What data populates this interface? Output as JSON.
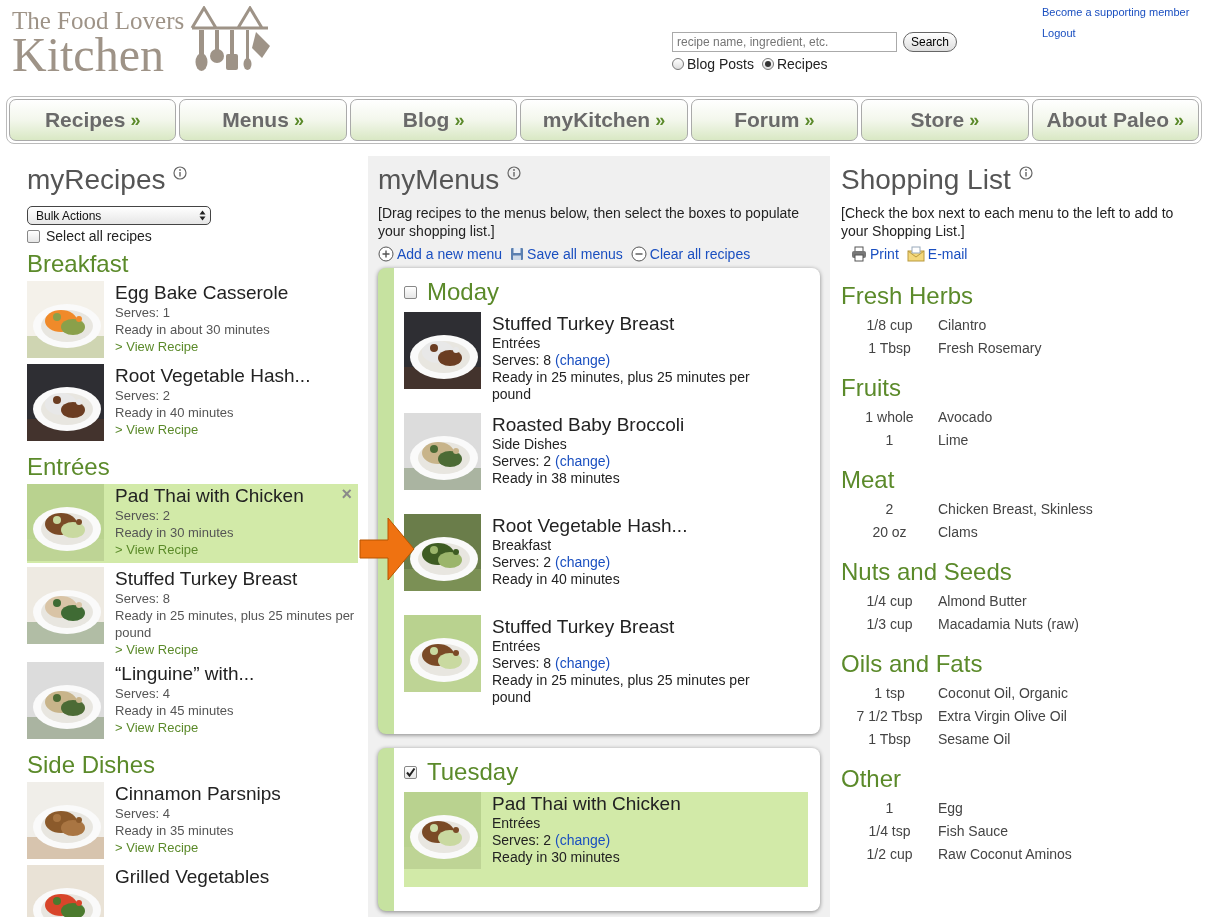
{
  "header": {
    "logo": {
      "line1": "The Food Lovers",
      "line2": "Kitchen"
    },
    "search": {
      "placeholder": "recipe name, ingredient, etc.",
      "button": "Search"
    },
    "scopes": [
      {
        "label": "Blog Posts",
        "selected": false
      },
      {
        "label": "Recipes",
        "selected": true
      }
    ],
    "account_links": [
      "Become a supporting member",
      "Logout"
    ]
  },
  "nav": [
    {
      "label": "Recipes",
      "suffix": "»"
    },
    {
      "label": "Menus",
      "suffix": "»"
    },
    {
      "label": "Blog",
      "suffix": "»"
    },
    {
      "label": "myKitchen",
      "suffix": "»"
    },
    {
      "label": "Forum",
      "suffix": "»"
    },
    {
      "label": "Store",
      "suffix": "»"
    },
    {
      "label": "About Paleo",
      "suffix": "»"
    }
  ],
  "my_recipes": {
    "title": "myRecipes",
    "bulk_actions": "Bulk Actions",
    "select_all": {
      "label": "Select all recipes",
      "checked": false
    },
    "groups": [
      {
        "name": "Breakfast",
        "recipes": [
          {
            "title": "Egg Bake Casserole",
            "serves": "Serves: 1",
            "ready": "Ready in about 30 minutes",
            "link": "> View Recipe",
            "highlighted": false
          },
          {
            "title": "Root Vegetable Hash...",
            "serves": "Serves: 2",
            "ready": "Ready in 40 minutes",
            "link": "> View Recipe",
            "highlighted": false
          }
        ]
      },
      {
        "name": "Entrées",
        "recipes": [
          {
            "title": "Pad Thai with Chicken",
            "serves": "Serves: 2",
            "ready": "Ready in 30 minutes",
            "link": "> View Recipe",
            "highlighted": true,
            "remove": "×"
          },
          {
            "title": "Stuffed Turkey Breast",
            "serves": "Serves: 8",
            "ready": "Ready in 25 minutes, plus 25 minutes per pound",
            "link": "> View Recipe",
            "highlighted": false
          },
          {
            "title": "“Linguine” with...",
            "serves": "Serves: 4",
            "ready": "Ready in 45 minutes",
            "link": "> View Recipe",
            "highlighted": false
          }
        ]
      },
      {
        "name": "Side Dishes",
        "recipes": [
          {
            "title": "Cinnamon Parsnips",
            "serves": "Serves: 4",
            "ready": "Ready in 35 minutes",
            "link": "> View Recipe",
            "highlighted": false
          },
          {
            "title": "Grilled Vegetables",
            "highlighted": false
          }
        ]
      }
    ]
  },
  "my_menus": {
    "title": "myMenus",
    "instructions": "[Drag recipes to the menus below, then select the boxes to populate your shopping list.]",
    "actions": [
      {
        "kind": "add",
        "label": "Add a new menu"
      },
      {
        "kind": "save",
        "label": "Save all menus"
      },
      {
        "kind": "clear",
        "label": "Clear all recipes"
      }
    ],
    "menus": [
      {
        "name": "Moday",
        "checked": false,
        "items": [
          {
            "title": "Stuffed Turkey Breast",
            "category": "Entrées",
            "serves": "Serves: 8",
            "change": "(change)",
            "ready": "Ready in 25 minutes, plus 25 minutes per pound",
            "highlighted": false
          },
          {
            "title": "Roasted Baby Broccoli",
            "category": "Side Dishes",
            "serves": "Serves: 2",
            "change": "(change)",
            "ready": "Ready in 38 minutes",
            "highlighted": false
          },
          {
            "title": "Root Vegetable Hash...",
            "category": "Breakfast",
            "serves": "Serves: 2",
            "change": "(change)",
            "ready": "Ready in 40 minutes",
            "highlighted": false
          },
          {
            "title": "Stuffed Turkey Breast",
            "category": "Entrées",
            "serves": "Serves: 8",
            "change": "(change)",
            "ready": "Ready in 25 minutes, plus 25 minutes per pound",
            "highlighted": false
          }
        ]
      },
      {
        "name": "Tuesday",
        "checked": true,
        "items": [
          {
            "title": "Pad Thai with Chicken",
            "category": "Entrées",
            "serves": "Serves: 2",
            "change": "(change)",
            "ready": "Ready in 30 minutes",
            "highlighted": true
          }
        ]
      }
    ]
  },
  "shopping_list": {
    "title": "Shopping List",
    "instructions": "[Check the box next to each menu to the left to add to your Shopping List.]",
    "actions": [
      {
        "kind": "print",
        "label": "Print"
      },
      {
        "kind": "email",
        "label": "E-mail"
      }
    ],
    "categories": [
      {
        "name": "Fresh Herbs",
        "items": [
          {
            "qty": "1/8 cup",
            "name": "Cilantro"
          },
          {
            "qty": "1 Tbsp",
            "name": "Fresh Rosemary"
          }
        ]
      },
      {
        "name": "Fruits",
        "items": [
          {
            "qty": "1 whole",
            "name": "Avocado"
          },
          {
            "qty": "1",
            "name": "Lime"
          }
        ]
      },
      {
        "name": "Meat",
        "items": [
          {
            "qty": "2",
            "name": "Chicken Breast, Skinless"
          },
          {
            "qty": "20 oz",
            "name": "Clams"
          }
        ]
      },
      {
        "name": "Nuts and Seeds",
        "items": [
          {
            "qty": "1/4 cup",
            "name": "Almond Butter"
          },
          {
            "qty": "1/3 cup",
            "name": "Macadamia Nuts (raw)"
          }
        ]
      },
      {
        "name": "Oils and Fats",
        "items": [
          {
            "qty": "1 tsp",
            "name": "Coconut Oil, Organic"
          },
          {
            "qty": "7 1/2 Tbsp",
            "name": "Extra Virgin Olive Oil"
          },
          {
            "qty": "1 Tbsp",
            "name": "Sesame Oil"
          }
        ]
      },
      {
        "name": "Other",
        "items": [
          {
            "qty": "1",
            "name": "Egg"
          },
          {
            "qty": "1/4 tsp",
            "name": "Fish Sauce"
          },
          {
            "qty": "1/2 cup",
            "name": "Raw Coconut Aminos"
          }
        ]
      }
    ]
  }
}
